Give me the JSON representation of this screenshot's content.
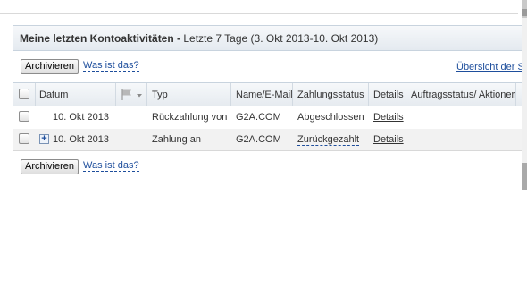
{
  "panel": {
    "title": "Meine letzten Kontoaktivitäten",
    "separator": " - ",
    "range_label": "Letzte 7 Tage (3. Okt 2013-10. Okt 2013)"
  },
  "toolbar_top": {
    "archive_label": "Archivieren",
    "whatis_label": "Was ist das?",
    "overview_label": "Übersicht der St"
  },
  "table": {
    "headers": {
      "date": "Datum",
      "type": "Typ",
      "name": "Name/E-Mail",
      "paystatus": "Zahlungsstatus",
      "details": "Details",
      "order": "Auftragsstatus/ Aktionen"
    },
    "rows": [
      {
        "date": "10. Okt 2013",
        "type": "Rückzahlung von",
        "name": "G2A.COM",
        "status": "Abgeschlossen",
        "details": "Details"
      },
      {
        "date": "10. Okt 2013",
        "type": "Zahlung an",
        "name": "G2A.COM",
        "status": "Zurückgezahlt",
        "details": "Details"
      }
    ]
  },
  "toolbar_bottom": {
    "archive_label": "Archivieren",
    "whatis_label": "Was ist das?"
  },
  "icons": {
    "flag": "flag-icon",
    "dropdown": "chevron-down-icon",
    "expand": "expand-plus-icon"
  },
  "colors": {
    "link": "#1e4e9c",
    "header_bg": "#e6ebf0"
  }
}
